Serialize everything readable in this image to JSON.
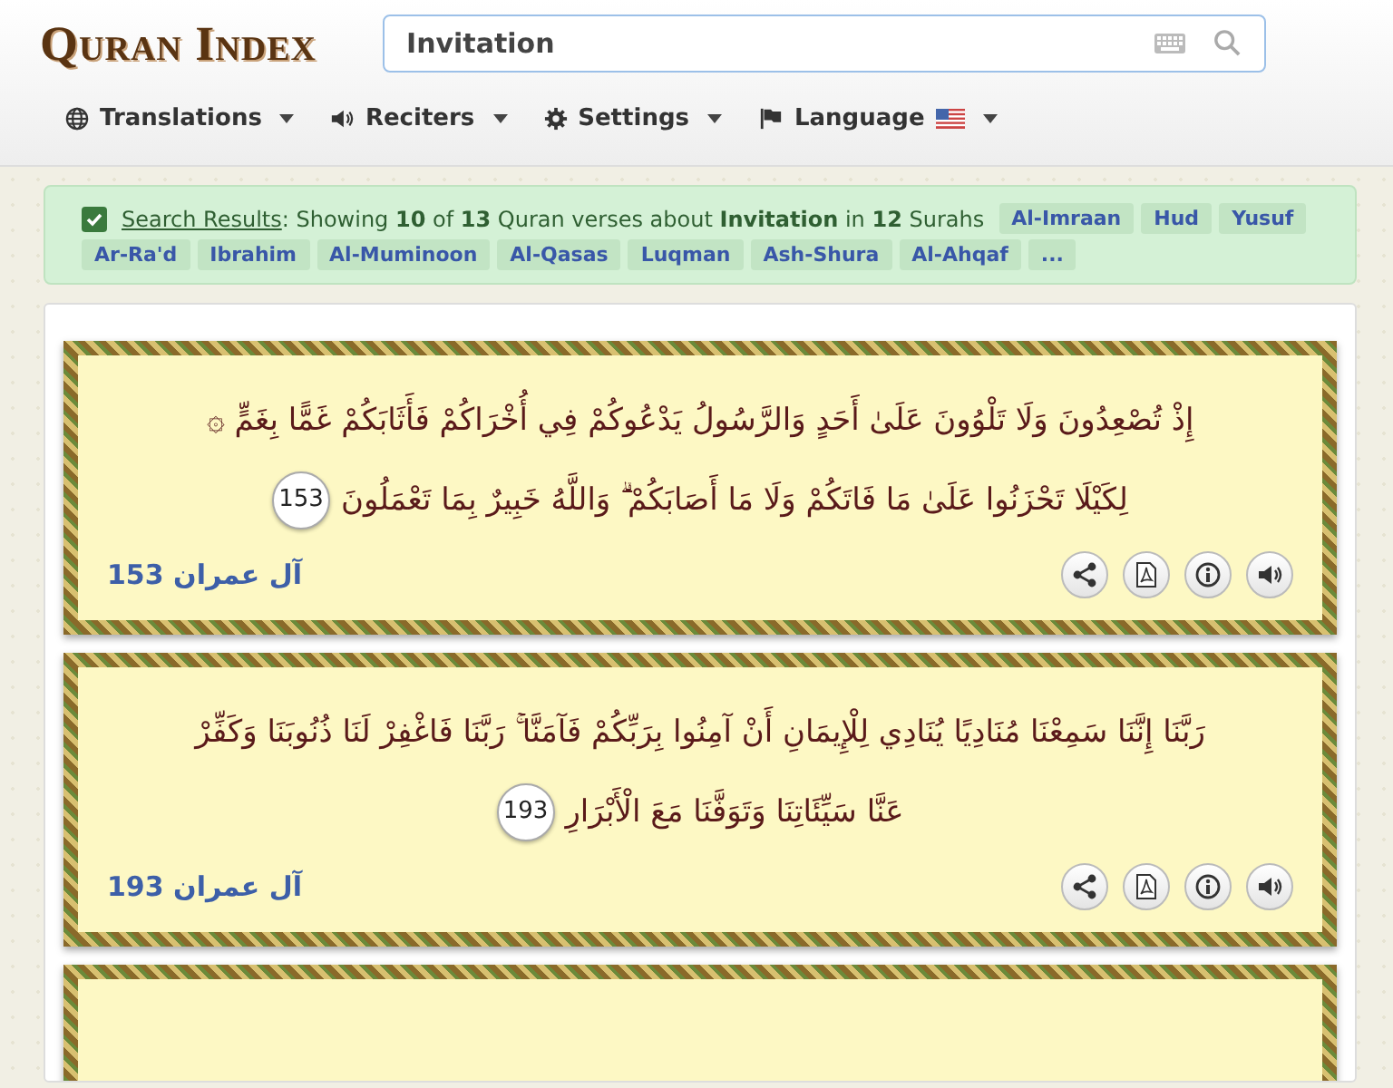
{
  "logo": {
    "text": "Quran Index"
  },
  "search": {
    "value": "Invitation"
  },
  "menu": [
    {
      "label": "Translations",
      "kind": "globe"
    },
    {
      "label": "Reciters",
      "kind": "speaker"
    },
    {
      "label": "Settings",
      "kind": "gear"
    },
    {
      "label": "Language",
      "kind": "flag"
    }
  ],
  "results": {
    "checked": true,
    "link": "Search Results",
    "text": ": Showing **10** of **13** Quran verses about **Invitation** in **12** Surahs",
    "tags": [
      "Al-Imraan",
      "Hud",
      "Yusuf",
      "Ar-Ra'd",
      "Ibrahim",
      "Al-Muminoon",
      "Al-Qasas",
      "Luqman",
      "Ash-Shura",
      "Al-Ahqaf",
      "..."
    ]
  },
  "verses": [
    {
      "lines": [
        "إِذْ تُصْعِدُونَ وَلَا تَلْوُونَ عَلَىٰ أَحَدٍ وَالرَّسُولُ يَدْعُوكُمْ فِي أُخْرَاكُمْ فَأَثَابَكُمْ غَمًّا بِغَمٍّ ۞",
        "لِكَيْلَا تَحْزَنُوا عَلَىٰ مَا فَاتَكُمْ وَلَا مَا أَصَابَكُمْ ۗ وَاللَّهُ خَبِيرٌ بِمَا تَعْمَلُونَ"
      ],
      "number": "153",
      "reference": "آل عمران 153"
    },
    {
      "lines": [
        "رَبَّنَا إِنَّنَا سَمِعْنَا مُنَادِيًا يُنَادِي لِلْإِيمَانِ أَنْ آمِنُوا بِرَبِّكُمْ فَآمَنَّا ۚ رَبَّنَا فَاغْفِرْ لَنَا ذُنُوبَنَا وَكَفِّرْ",
        "عَنَّا سَيِّئَاتِنَا وَتَوَفَّنَا مَعَ الْأَبْرَارِ"
      ],
      "number": "193",
      "reference": "آل عمران 193"
    }
  ]
}
